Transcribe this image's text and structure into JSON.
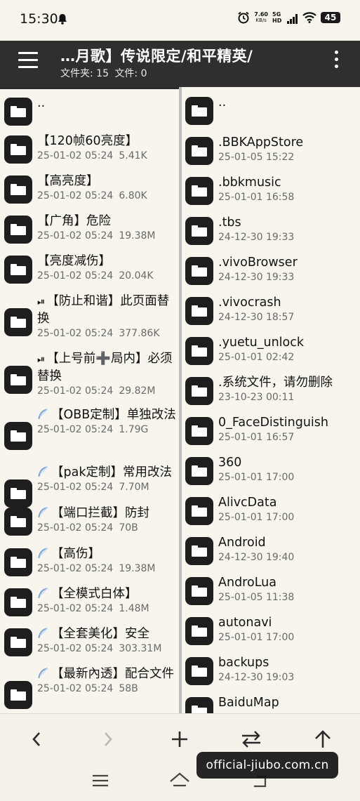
{
  "status": {
    "time": "15:30",
    "net_speed": "7.60",
    "net_unit": "KB/s",
    "signal": "5G HD",
    "battery": "45"
  },
  "header": {
    "title": "…月歌】传说限定/和平精英/",
    "folders_label": "文件夹: 15",
    "files_label": "文件: 0"
  },
  "left_items": [
    {
      "prefix": "",
      "name": "..",
      "date": "",
      "size": ""
    },
    {
      "prefix": "",
      "name": "【120帧60亮度】",
      "date": "25-01-02 05:24",
      "size": "5.41K"
    },
    {
      "prefix": "",
      "name": "【高亮度】",
      "date": "25-01-02 05:24",
      "size": "6.80K"
    },
    {
      "prefix": "",
      "name": "【广角】危险",
      "date": "25-01-02 05:24",
      "size": "19.38M"
    },
    {
      "prefix": "",
      "name": "【亮度减伤】",
      "date": "25-01-02 05:24",
      "size": "20.04K"
    },
    {
      "prefix": "⏯",
      "name": "【防止和谐】此页面替换",
      "date": "25-01-02 05:24",
      "size": "377.86K"
    },
    {
      "prefix": "⏯",
      "name": "【上号前➕局内】必须替换",
      "date": "25-01-02 05:24",
      "size": "29.82M"
    },
    {
      "prefix": "feather",
      "name": "【OBB定制】单独改法",
      "date": "25-01-02 05:24",
      "size": "1.79G"
    },
    {
      "prefix": "feather",
      "name": "【pak定制】常用改法",
      "date": "25-01-02 05:24",
      "size": "7.70M"
    },
    {
      "prefix": "feather",
      "name": "【端口拦截】防封",
      "date": "25-01-02 05:24",
      "size": "70B"
    },
    {
      "prefix": "feather",
      "name": "【高伤】",
      "date": "25-01-02 05:24",
      "size": "19.38M"
    },
    {
      "prefix": "feather",
      "name": "【全模式白体】",
      "date": "25-01-02 05:24",
      "size": "1.48M"
    },
    {
      "prefix": "feather",
      "name": "【全套美化】安全",
      "date": "25-01-02 05:24",
      "size": "303.31M"
    },
    {
      "prefix": "feather",
      "name": "【最新內透】配合文件",
      "date": "25-01-02 05:24",
      "size": "58B"
    }
  ],
  "right_items": [
    {
      "name": "..",
      "date": ""
    },
    {
      "name": ".BBKAppStore",
      "date": "25-01-05 15:22"
    },
    {
      "name": ".bbkmusic",
      "date": "25-01-01 16:58"
    },
    {
      "name": ".tbs",
      "date": "24-12-30 19:33"
    },
    {
      "name": ".vivoBrowser",
      "date": "24-12-30 19:33"
    },
    {
      "name": ".vivocrash",
      "date": "24-12-30 18:57"
    },
    {
      "name": ".yuetu_unlock",
      "date": "25-01-01 02:42"
    },
    {
      "name": ".系统文件，请勿删除",
      "date": "23-10-23 00:11"
    },
    {
      "name": "0_FaceDistinguish",
      "date": "25-01-01 16:57"
    },
    {
      "name": "360",
      "date": "25-01-01 17:00"
    },
    {
      "name": "AlivcData",
      "date": "25-01-01 17:00"
    },
    {
      "name": "Android",
      "date": "24-12-30 19:40"
    },
    {
      "name": "AndroLua",
      "date": "25-01-05 11:38"
    },
    {
      "name": "autonavi",
      "date": "25-01-01 17:00"
    },
    {
      "name": "backups",
      "date": "24-12-30 19:03"
    },
    {
      "name": "BaiduMap",
      "date": ""
    }
  ],
  "toolbar": {
    "back_icon": "chevron-left-icon",
    "forward_icon": "chevron-right-icon",
    "add_icon": "plus-icon",
    "swap_icon": "swap-arrows-icon",
    "up_icon": "arrow-up-icon"
  },
  "watermark": "official-jiubo.com.cn"
}
